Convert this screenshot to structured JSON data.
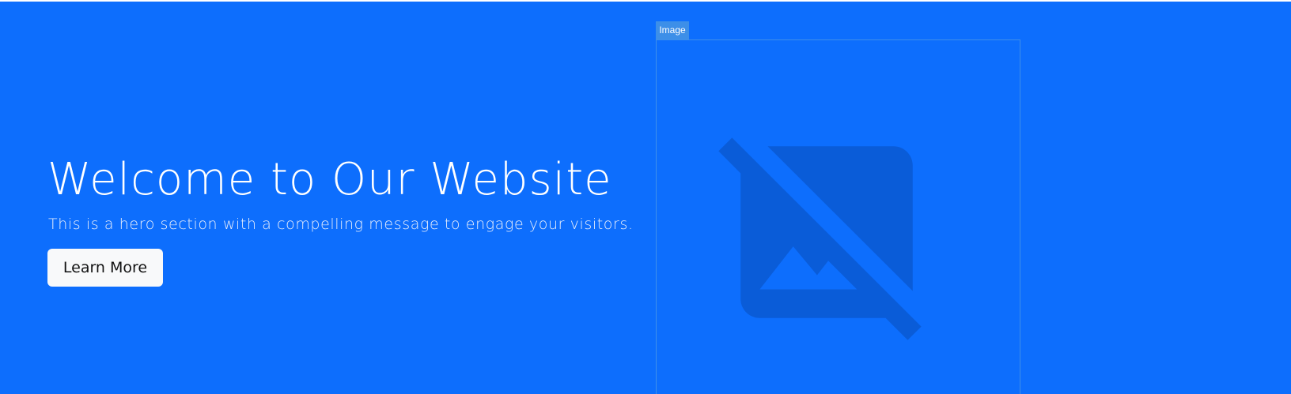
{
  "hero": {
    "title": "Welcome to Our Website",
    "subtitle": "This is a hero section with a compelling message to engage your visitors.",
    "button_label": "Learn More",
    "background_color": "#0d6efd"
  },
  "image_block": {
    "tag_label": "Image",
    "icon": "image-not-supported-icon"
  }
}
